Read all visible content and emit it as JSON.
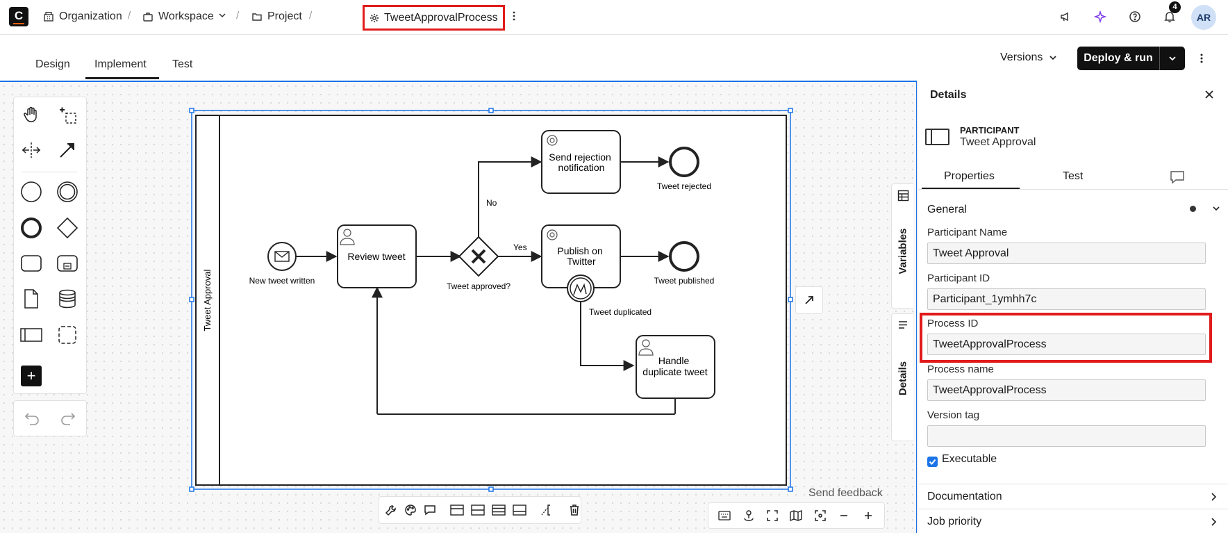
{
  "app": {
    "logo_letter": "C"
  },
  "breadcrumb": {
    "organization": "Organization",
    "workspace": "Workspace",
    "project": "Project",
    "process": "TweetApprovalProcess",
    "separator": "/"
  },
  "header": {
    "notification_count": "4",
    "avatar_initials": "AR"
  },
  "tabs": {
    "design": "Design",
    "implement": "Implement",
    "test": "Test",
    "active": "Implement"
  },
  "actions": {
    "versions": "Versions",
    "deploy": "Deploy & run"
  },
  "canvas": {
    "side_tabs": {
      "variables": "Variables",
      "details": "Details"
    },
    "send_feedback": "Send feedback"
  },
  "diagram": {
    "pool_label": "Tweet Approval",
    "start_event": "New tweet written",
    "review_task": "Review tweet",
    "gateway": "Tweet approved?",
    "flow_no": "No",
    "flow_yes": "Yes",
    "rejection_task": [
      "Send rejection",
      "notification"
    ],
    "publish_task": [
      "Publish on",
      "Twitter"
    ],
    "duplicate_task": [
      "Handle",
      "duplicate tweet"
    ],
    "end_rejected": "Tweet rejected",
    "end_published": "Tweet published",
    "boundary_error": "Tweet duplicated"
  },
  "details": {
    "title": "Details",
    "element_kind": "PARTICIPANT",
    "element_name": "Tweet Approval",
    "tabs": {
      "properties": "Properties",
      "test": "Test"
    },
    "section": "General",
    "fields": {
      "participant_name": {
        "label": "Participant Name",
        "value": "Tweet Approval"
      },
      "participant_id": {
        "label": "Participant ID",
        "value": "Participant_1ymhh7c"
      },
      "process_id": {
        "label": "Process ID",
        "value": "TweetApprovalProcess"
      },
      "process_name": {
        "label": "Process name",
        "value": "TweetApprovalProcess"
      },
      "version_tag": {
        "label": "Version tag",
        "value": ""
      }
    },
    "executable": {
      "label": "Executable",
      "checked": true
    },
    "accordions": {
      "documentation": "Documentation",
      "job_priority": "Job priority"
    }
  },
  "colors": {
    "accent": "#1a73e8",
    "highlight": "#e11b1b",
    "ai": "#7c3aed",
    "brand": "#fc5d0d"
  }
}
